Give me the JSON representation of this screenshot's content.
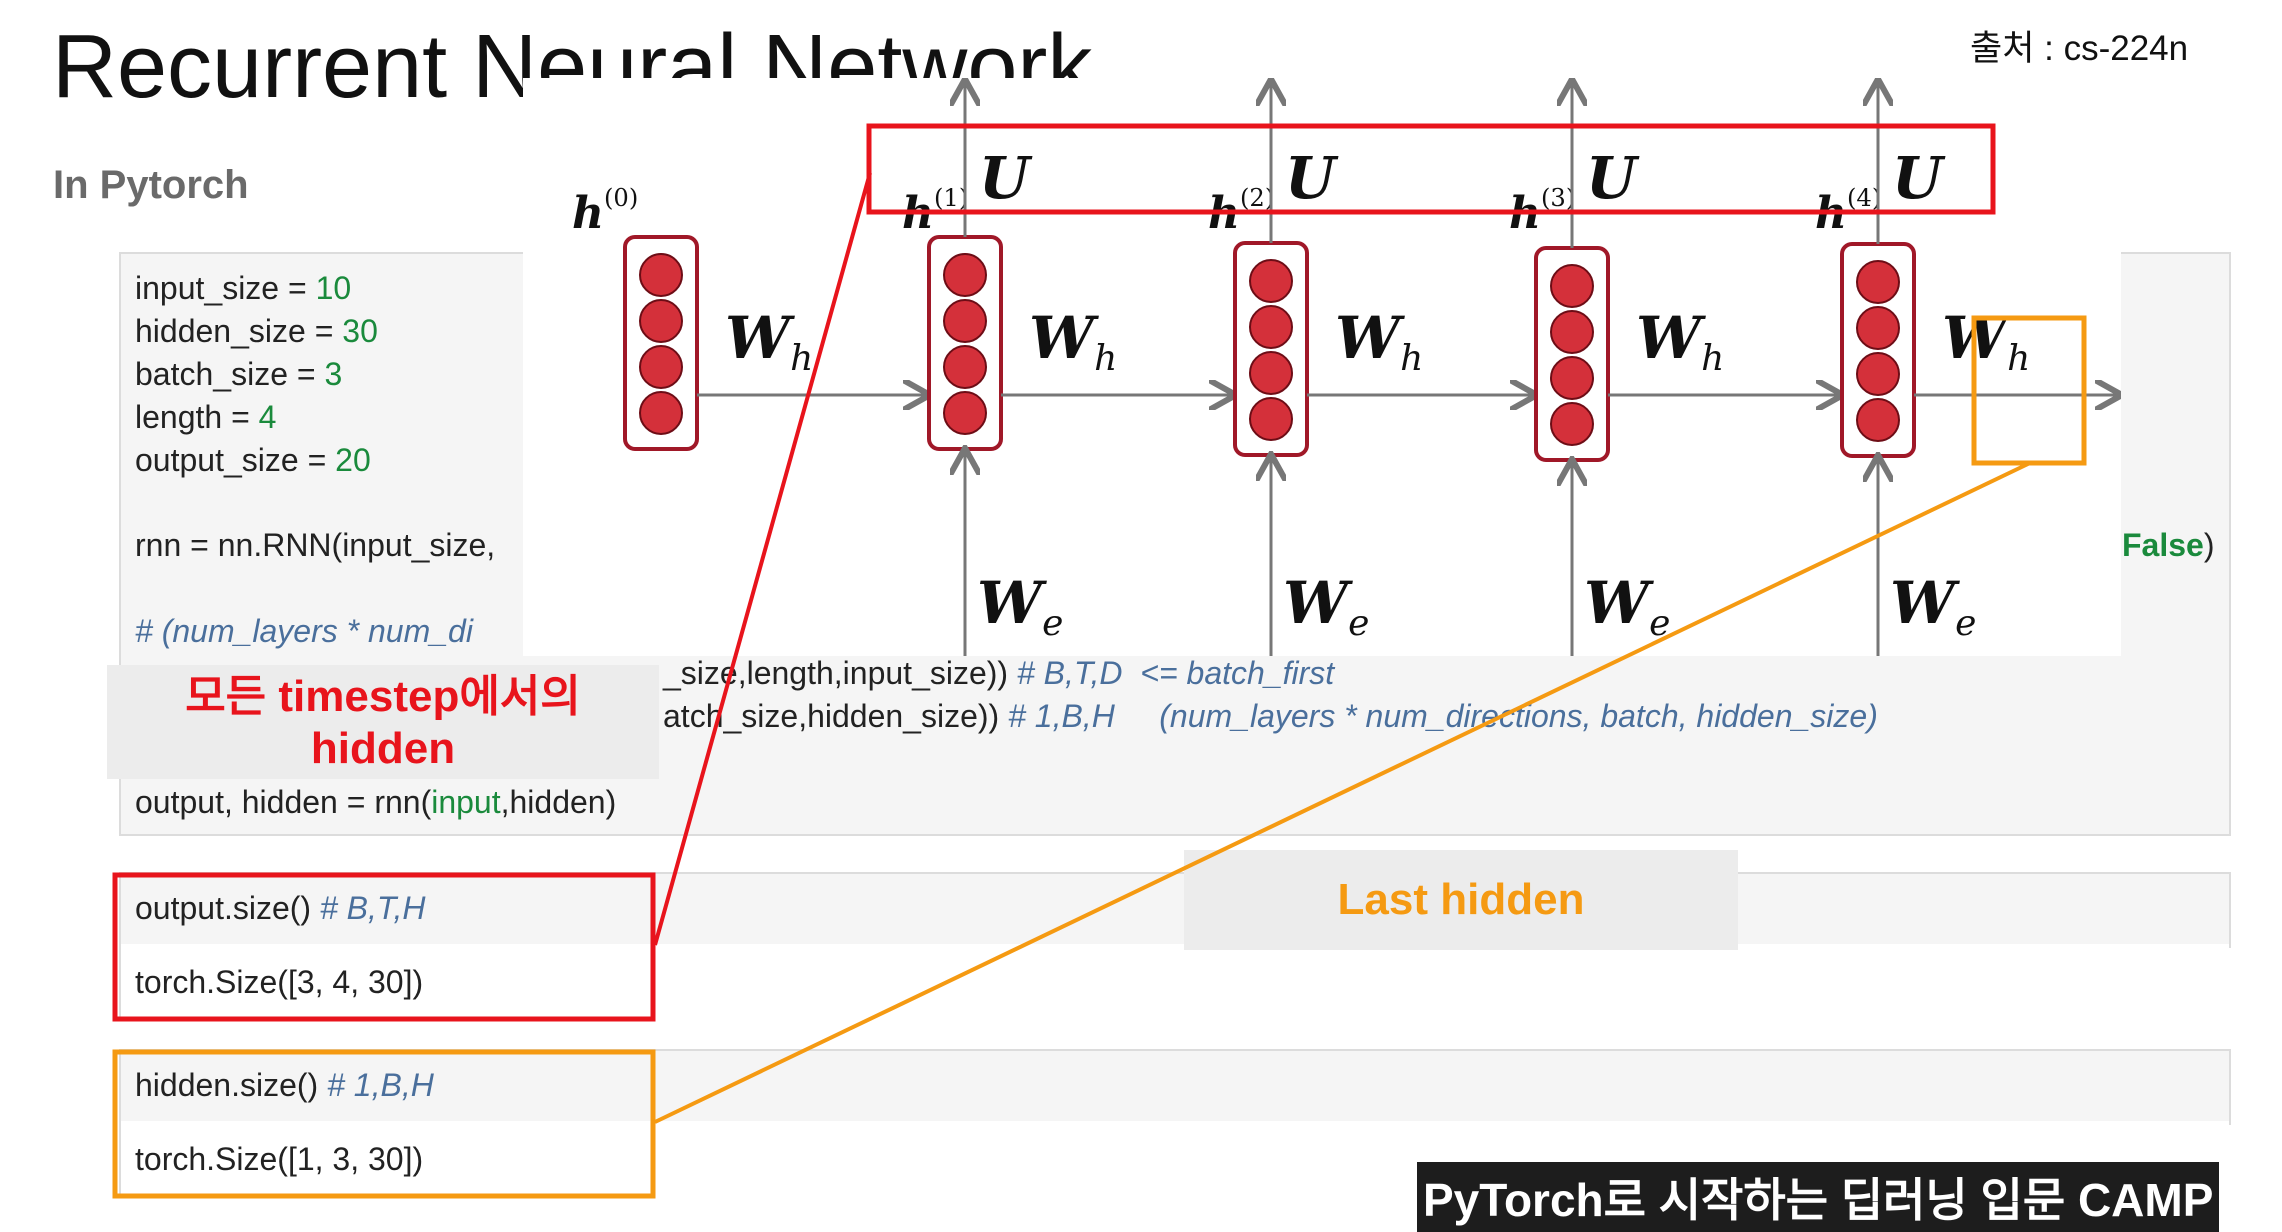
{
  "slide": {
    "title": "Recurrent Neural Network",
    "subtitle": "In Pytorch",
    "source": "출처 : cs-224n",
    "footer": "PyTorch로 시작하는 딥러닝 입문 CAMP"
  },
  "code": {
    "input_size": {
      "name": "input_size = ",
      "value": "10"
    },
    "hidden_size": {
      "name": "hidden_size = ",
      "value": "30"
    },
    "batch_size": {
      "name": "batch_size = ",
      "value": "3"
    },
    "length": {
      "name": "length = ",
      "value": "4"
    },
    "output_size": {
      "name": "output_size = ",
      "value": "20"
    },
    "rnn_start": "rnn = nn.RNN(input_size,",
    "rnn_end_value": "False",
    "rnn_end_paren": ")",
    "comment": "# (num_layers * num_di",
    "input_line": "_size,length,input_size))",
    "input_comment": "# B,T,D  <= batch_first",
    "hidden_line": "atch_size,hidden_size))",
    "hidden_comment": "# 1,B,H     (num_layers * num_directions, batch, hidden_size)",
    "forward_pre": "output, hidden = rnn(",
    "forward_arg": "input",
    "forward_post": ",hidden)",
    "output_size_call": "output.size()",
    "output_size_comment": "# B,T,H",
    "output_size_result": "torch.Size([3, 4, 30])",
    "hidden_size_call": "hidden.size()",
    "hidden_size_comment": "# 1,B,H",
    "hidden_size_result": "torch.Size([1, 3, 30])"
  },
  "diagram": {
    "h_labels": [
      "h",
      "h",
      "h",
      "h",
      "h"
    ],
    "h_superscripts": [
      "(0)",
      "(1)",
      "(2)",
      "(3)",
      "(4)"
    ],
    "output_weight": "U",
    "hidden_weight": "W",
    "hidden_weight_sub": "h",
    "input_weight": "W",
    "input_weight_sub": "e"
  },
  "annotations": {
    "all_hidden_line1": "모든 timestep에서의",
    "all_hidden_line2": "hidden",
    "last_hidden": "Last hidden"
  },
  "colors": {
    "red": "#e8141c",
    "orange": "#f59a12",
    "cell_border": "#a01828",
    "neuron": "#d4303a",
    "code_number": "#1a8a3c",
    "code_comment": "#4a6f9c"
  }
}
